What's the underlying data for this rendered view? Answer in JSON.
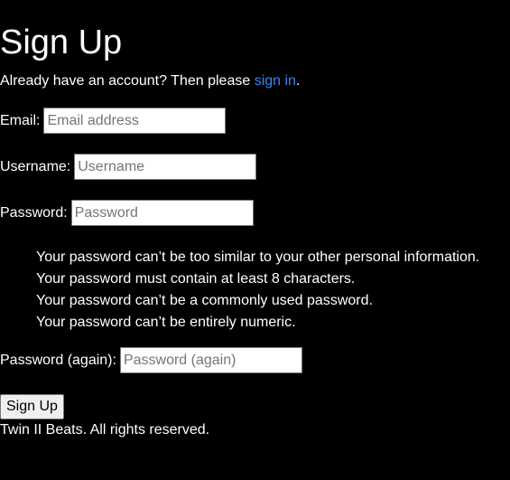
{
  "page": {
    "title": "Sign Up",
    "intro_text": "Already have an account? Then please ",
    "intro_link": "sign in",
    "intro_end": "."
  },
  "form": {
    "email": {
      "label": "Email:",
      "placeholder": "Email address",
      "value": ""
    },
    "username": {
      "label": "Username:",
      "placeholder": "Username",
      "value": ""
    },
    "password": {
      "label": "Password:",
      "placeholder": "Password",
      "value": ""
    },
    "help": [
      "Your password can’t be too similar to your other personal information.",
      "Your password must contain at least 8 characters.",
      "Your password can’t be a commonly used password.",
      "Your password can’t be entirely numeric."
    ],
    "password2": {
      "label": "Password (again):",
      "placeholder": "Password (again)",
      "value": ""
    },
    "submit_label": "Sign Up"
  },
  "footer": {
    "text": "Twin II Beats. All rights reserved."
  },
  "colors": {
    "background": "#000000",
    "text": "#ffffff",
    "link": "#3b82f6"
  }
}
